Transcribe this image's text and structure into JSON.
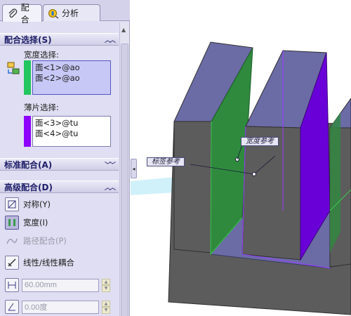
{
  "tabs": [
    {
      "label": "配合",
      "icon": "paperclip-icon",
      "active": true
    },
    {
      "label": "分析",
      "icon": "analysis-icon",
      "active": false
    }
  ],
  "sections": {
    "mate_selections": {
      "title": "配合选择(S)",
      "width_label": "宽度选择:",
      "width_items": [
        "面<1>@ao",
        "面<2>@ao"
      ],
      "tab_label": "薄片选择:",
      "tab_items": [
        "面<3>@tu",
        "面<4>@tu"
      ]
    },
    "standard": {
      "title": "标准配合(A)"
    },
    "advanced": {
      "title": "高级配合(D)",
      "options": [
        {
          "label": "对称(Y)",
          "icon": "symmetric-icon",
          "selected": false,
          "enabled": true
        },
        {
          "label": "宽度(I)",
          "icon": "width-icon",
          "selected": true,
          "enabled": true
        },
        {
          "label": "路径配合(P)",
          "icon": "path-mate-icon",
          "selected": false,
          "enabled": false
        },
        {
          "label": "线性/线性耦合",
          "icon": "linear-coupler-icon",
          "selected": false,
          "enabled": true
        }
      ],
      "distance_value": "60.00mm",
      "angle_value": "0.00度"
    }
  },
  "viewport": {
    "callout_width": "宽度参考",
    "callout_tab": "标签参考"
  },
  "colors": {
    "panel_bg": "#dfdef2",
    "selection_green": "#22c55e",
    "selection_purple": "#8b00ff",
    "part_top": "#6b6ba6",
    "part_front": "#5c5c5c",
    "face_green": "#2f8a3e",
    "face_purple": "#6a00d8"
  }
}
